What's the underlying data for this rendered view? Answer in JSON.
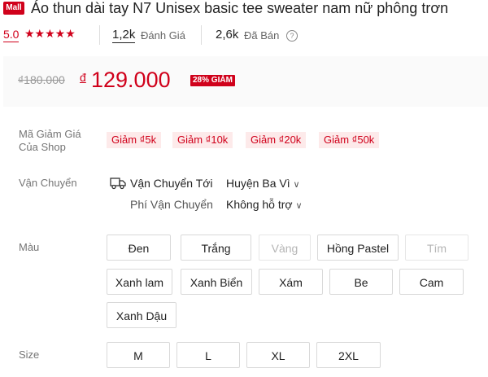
{
  "header": {
    "mall_badge": "Mall",
    "title": "Áo thun dài tay N7 Unisex basic tee sweater nam nữ phông trơn",
    "rating_value": "5.0",
    "stars": "★★★★★",
    "ratings_count": "1,2k",
    "ratings_label": "Đánh Giá",
    "sold_count": "2,6k",
    "sold_label": "Đã Bán",
    "help_icon": "?"
  },
  "price": {
    "old": "₫180.000",
    "currency": "đ",
    "current": "129.000",
    "discount": "28% GIẢM"
  },
  "vouchers": {
    "label_line1": "Mã Giảm Giá",
    "label_line2": "Của Shop",
    "items": [
      "Giảm ₫5k",
      "Giảm ₫10k",
      "Giảm ₫20k",
      "Giảm ₫50k"
    ]
  },
  "shipping": {
    "label": "Vận Chuyển",
    "to_label": "Vận Chuyển Tới",
    "to_value": "Huyện Ba Vì",
    "fee_label": "Phí Vận Chuyển",
    "fee_value": "Không hỗ trợ"
  },
  "color": {
    "label": "Màu",
    "options": [
      {
        "label": "Đen",
        "enabled": true
      },
      {
        "label": "Trắng",
        "enabled": true
      },
      {
        "label": "Vàng",
        "enabled": false
      },
      {
        "label": "Hồng Pastel",
        "enabled": true
      },
      {
        "label": "Tím",
        "enabled": false
      },
      {
        "label": "Xanh lam",
        "enabled": true
      },
      {
        "label": "Xanh Biển",
        "enabled": true
      },
      {
        "label": "Xám",
        "enabled": true
      },
      {
        "label": "Be",
        "enabled": true
      },
      {
        "label": "Cam",
        "enabled": true
      },
      {
        "label": "Xanh Dậu",
        "enabled": true
      }
    ]
  },
  "size": {
    "label": "Size",
    "options": [
      "M",
      "L",
      "XL",
      "2XL"
    ]
  },
  "colors": {
    "accent": "#d0011b",
    "voucher_bg": "#fdeaea"
  }
}
